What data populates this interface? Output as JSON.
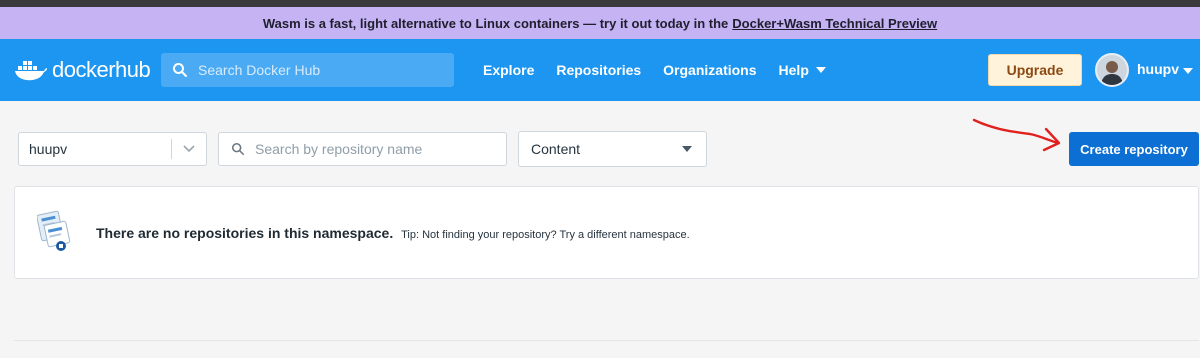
{
  "banner": {
    "text": "Wasm is a fast, light alternative to Linux containers — try it out today in the",
    "link": "Docker+Wasm Technical Preview"
  },
  "nav": {
    "logo_word1": "docker",
    "logo_word2": "hub",
    "search_placeholder": "Search Docker Hub",
    "links": [
      "Explore",
      "Repositories",
      "Organizations",
      "Help"
    ],
    "upgrade_label": "Upgrade",
    "username": "huupv"
  },
  "filters": {
    "namespace_value": "huupv",
    "repo_search_placeholder": "Search by repository name",
    "content_value": "Content",
    "create_label": "Create repository"
  },
  "empty_state": {
    "message": "There are no repositories in this namespace.",
    "tip": "Tip: Not finding your repository? Try a different namespace."
  },
  "colors": {
    "nav_bg": "#1d96f1",
    "banner_bg": "#c5b3f3",
    "primary_button": "#0b6fd3",
    "annotation_arrow": "#e0211e"
  }
}
